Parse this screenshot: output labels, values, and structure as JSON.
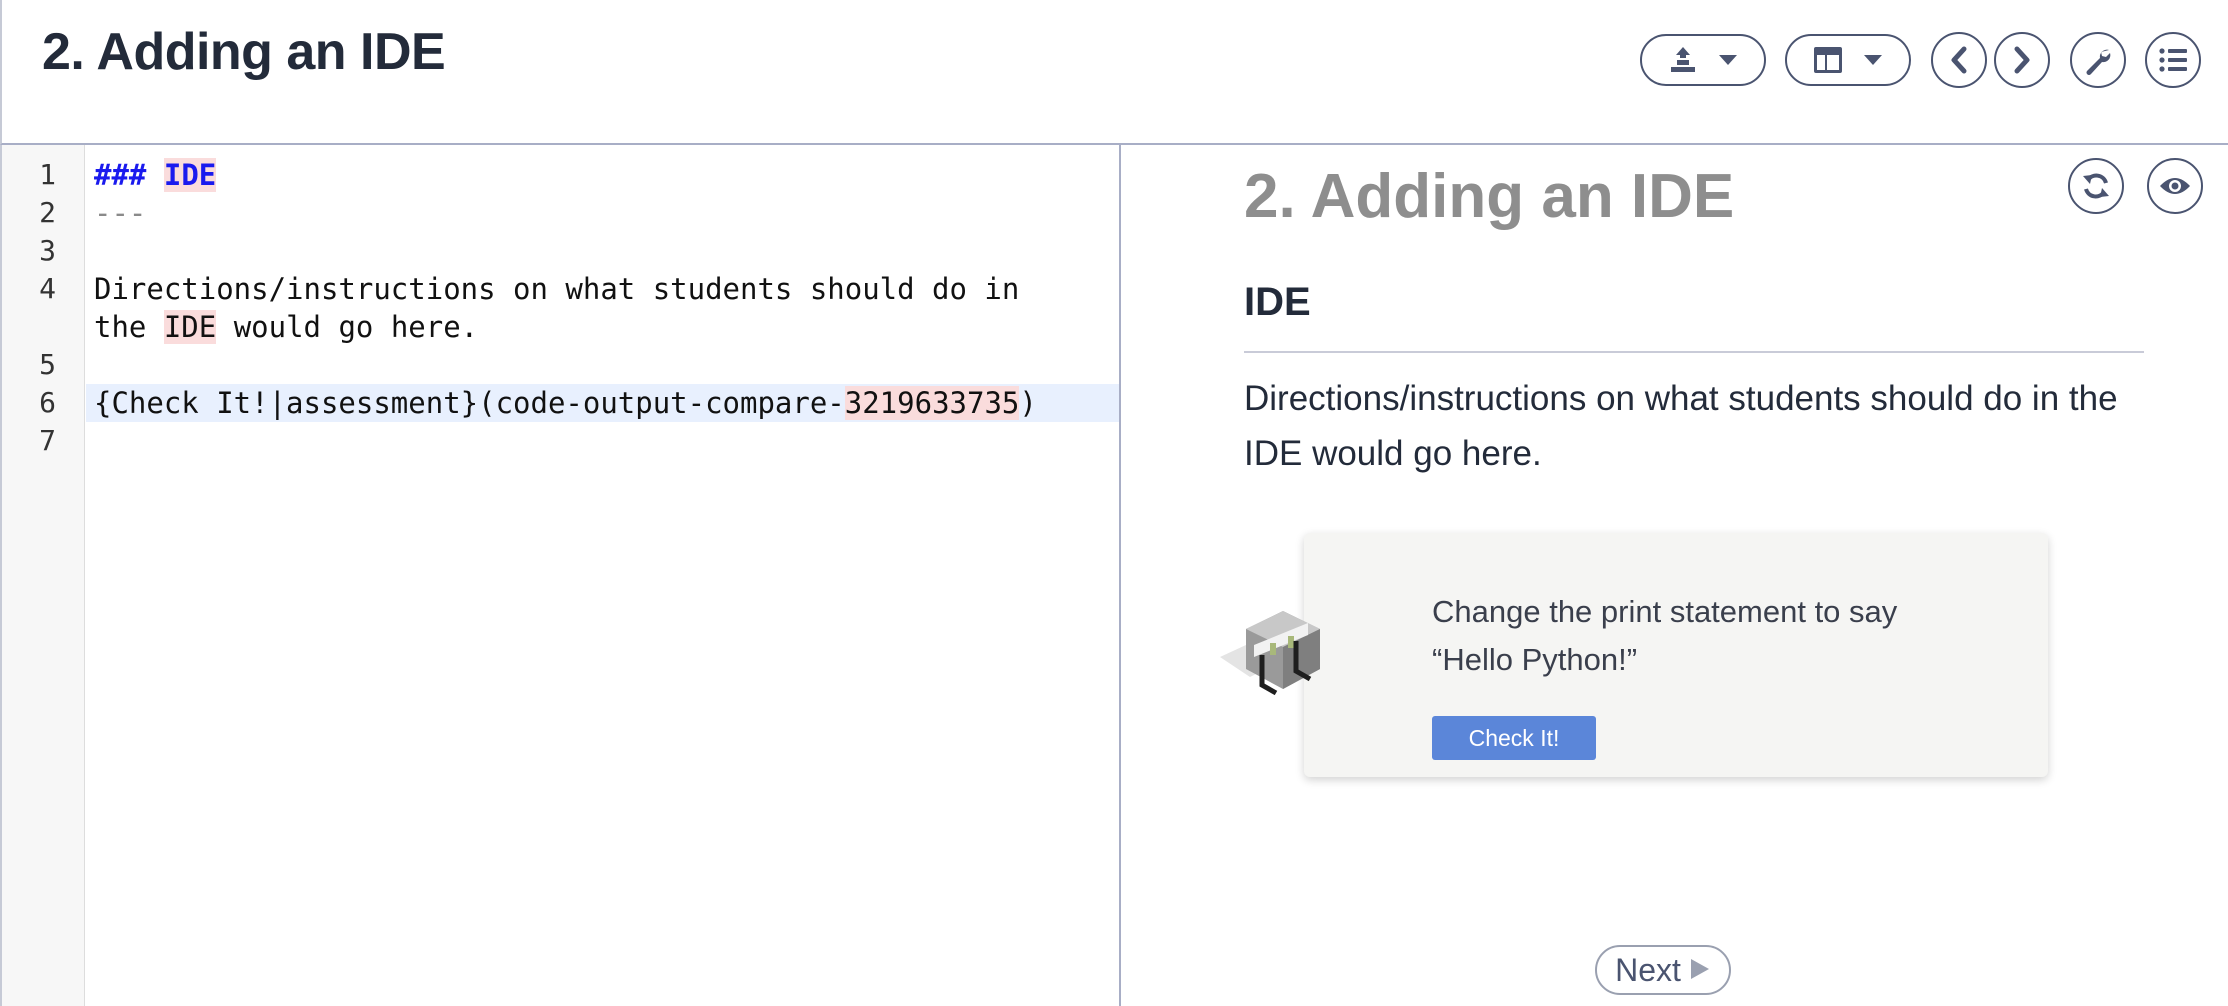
{
  "header": {
    "title": "2. Adding an IDE",
    "buttons": {
      "teacher": "teacher-hat-icon",
      "layout": "layout-icon",
      "prev": "chevron-left-icon",
      "next": "chevron-right-icon",
      "settings": "wrench-icon",
      "toc": "list-icon"
    }
  },
  "editor": {
    "lines": [
      {
        "no": "1",
        "text": "### IDE"
      },
      {
        "no": "2",
        "text": "---"
      },
      {
        "no": "3",
        "text": ""
      },
      {
        "no": "4",
        "text": "Directions/instructions on what students should do in the IDE would go here."
      },
      {
        "no": "5",
        "text": ""
      },
      {
        "no": "6",
        "text": "{Check It!|assessment}(code-output-compare-3219633735)"
      },
      {
        "no": "7",
        "text": ""
      }
    ],
    "line1": {
      "hashes": "###",
      "word": "IDE"
    },
    "line2": "---",
    "line4": {
      "a": "Directions/instructions on what students should do in",
      "b_pre": "the ",
      "b_hl": "IDE",
      "b_post": " would go here."
    },
    "line6": {
      "pre": "{Check It!|assessment}(code-output-compare-",
      "hl": "3219633735",
      "post": ")"
    }
  },
  "preview": {
    "title": "2. Adding an IDE",
    "heading": "IDE",
    "paragraph": "Directions/instructions on what students should do in the IDE would go here.",
    "assessment": {
      "prompt": "Change the print statement to say “Hello Python!”",
      "button": "Check It!",
      "image_icon": "hurdle-icon"
    },
    "icons": {
      "refresh": "refresh-icon",
      "view": "eye-icon"
    },
    "next_label": "Next"
  },
  "colors": {
    "accent": "#5b86d9",
    "title": "#232b3a",
    "preview_title": "#8e8e8e",
    "markdown_heading": "#1a1aee",
    "highlight": "#fadcdc",
    "active_line": "#e8f0fe"
  }
}
